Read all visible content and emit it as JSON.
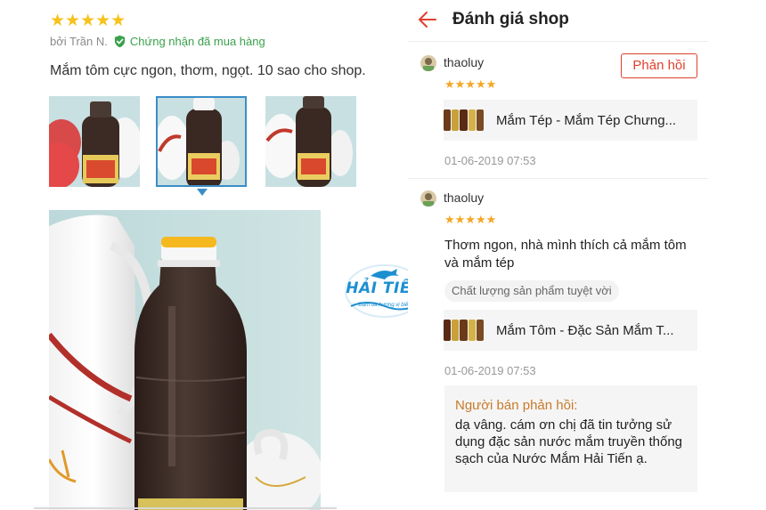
{
  "left_review": {
    "rating_stars": "★★★★★",
    "byline": "bởi Trần N.",
    "verified_label": "Chứng nhận đã mua hàng",
    "review_text": "Mắm tôm cực ngon,  thơm, ngọt. 10 sao cho shop.",
    "photo_count": 3,
    "active_photo_index": 1
  },
  "logo": {
    "name": "HẢI TIẾN",
    "tagline": "Đậm đà hương vị biển"
  },
  "app": {
    "title": "Đánh giá shop",
    "reply_button": "Phản hồi",
    "reviews": [
      {
        "username": "thaoluy",
        "stars": "★★★★★",
        "product_name": "Mắm Tép - Mắm Tép Chưng...",
        "timestamp": "01-06-2019 07:53"
      },
      {
        "username": "thaoluy",
        "stars": "★★★★★",
        "comment": "Thơm ngon, nhà mình thích cả mắm tôm và mắm tép",
        "tag": "Chất lượng sản phẩm tuyệt vời",
        "product_name": "Mắm Tôm - Đặc Sản Mắm T...",
        "timestamp": "01-06-2019 07:53",
        "seller_reply_label": "Người bán phản hồi:",
        "seller_reply_text": "dạ vâng. cám ơn chị đã tin tưởng sử dụng đặc sản nước mắm truyền thống sạch của Nước Mắm Hải Tiến ạ."
      }
    ]
  },
  "colors": {
    "accent_red": "#e0402e",
    "star_gold": "#f6c21c",
    "verified_green": "#3aa14c",
    "thumb_active_border": "#3a8ec7",
    "seller_label": "#c87a2a",
    "logo_blue": "#1d8fd0"
  },
  "icons": [
    "verified-check-icon",
    "back-arrow-icon",
    "avatar-icon"
  ]
}
